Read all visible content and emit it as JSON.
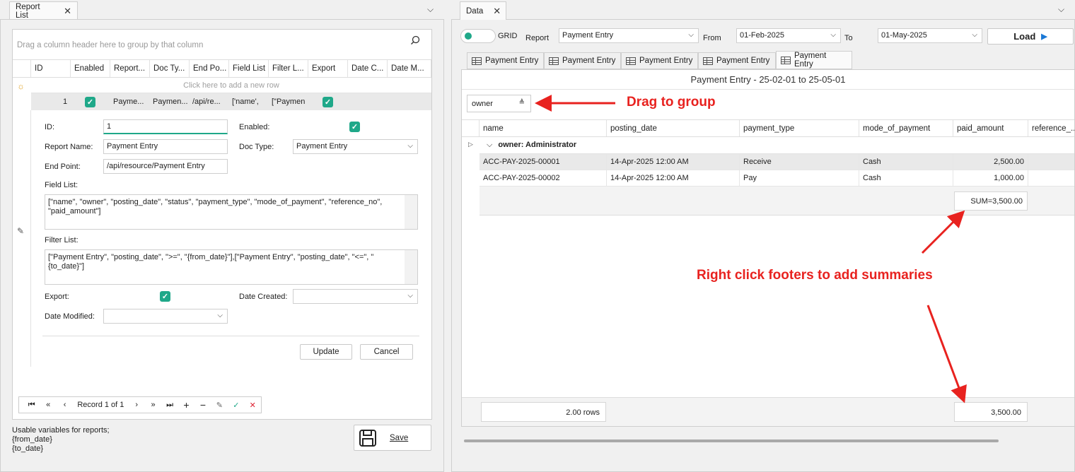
{
  "left": {
    "tab": "Report List",
    "group_hint": "Drag a column header here to group by that column",
    "columns": [
      "ID",
      "Enabled",
      "Report...",
      "Doc Ty...",
      "End Po...",
      "Field List",
      "Filter L...",
      "Export",
      "Date C...",
      "Date M..."
    ],
    "new_row_hint": "Click here to add a new row",
    "row": {
      "id": "1",
      "report": "Payme...",
      "doctype": "Paymen...",
      "endpoint": "/api/re...",
      "fields": "['name',",
      "filter": "[\"Paymen"
    },
    "form": {
      "id_label": "ID:",
      "id_value": "1",
      "enabled_label": "Enabled:",
      "report_name_label": "Report Name:",
      "report_name_value": "Payment Entry",
      "doc_type_label": "Doc Type:",
      "doc_type_value": "Payment Entry",
      "end_point_label": "End Point:",
      "end_point_value": "/api/resource/Payment Entry",
      "field_list_label": "Field List:",
      "field_list_value": "[\"name\", \"owner\", \"posting_date\", \"status\", \"payment_type\", \"mode_of_payment\", \"reference_no\", \"paid_amount\"]",
      "filter_list_label": "Filter List:",
      "filter_list_value": "[\"Payment Entry\", \"posting_date\", \">=\", \"{from_date}\"],[\"Payment Entry\", \"posting_date\", \"<=\", \"{to_date}\"]",
      "export_label": "Export:",
      "date_created_label": "Date Created:",
      "date_modified_label": "Date Modified:",
      "update": "Update",
      "cancel": "Cancel"
    },
    "nav_record": "Record 1 of 1",
    "usable_vars": [
      "Usable variables for reports;",
      "{from_date}",
      "{to_date}"
    ],
    "save": "Save"
  },
  "right": {
    "tab": "Data",
    "grid_toggle": "GRID",
    "report_label": "Report",
    "report_value": "Payment Entry",
    "from_label": "From",
    "from_value": "01-Feb-2025",
    "to_label": "To",
    "to_value": "01-May-2025",
    "load": "Load",
    "tabs": [
      "Payment Entry",
      "Payment Entry",
      "Payment Entry",
      "Payment Entry",
      "Payment Entry"
    ],
    "title": "Payment Entry - 25-02-01 to 25-05-01",
    "group_chip": "owner",
    "columns": [
      "name",
      "posting_date",
      "payment_type",
      "mode_of_payment",
      "paid_amount",
      "reference_..."
    ],
    "group_row": "owner: Administrator",
    "rows": [
      {
        "name": "ACC-PAY-2025-00001",
        "posting_date": "14-Apr-2025 12:00 AM",
        "payment_type": "Receive",
        "mode": "Cash",
        "amount": "2,500.00"
      },
      {
        "name": "ACC-PAY-2025-00002",
        "posting_date": "14-Apr-2025 12:00 AM",
        "payment_type": "Pay",
        "mode": "Cash",
        "amount": "1,000.00"
      }
    ],
    "group_sum": "SUM=3,500.00",
    "footer_count": "2.00 rows",
    "footer_total": "3,500.00"
  },
  "annotations": {
    "drag": "Drag to group",
    "right_click": "Right click footers to add summaries",
    "color": "#e8221f"
  }
}
